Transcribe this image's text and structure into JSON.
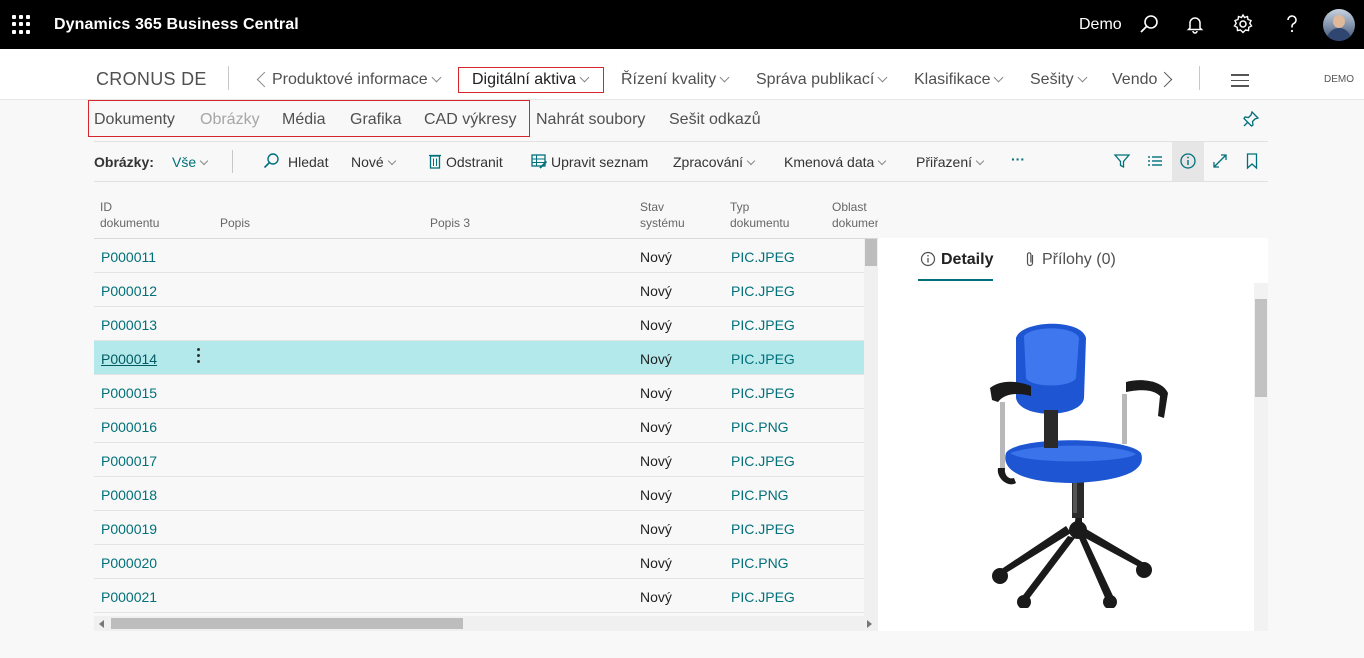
{
  "topbar": {
    "app_title": "Dynamics 365 Business Central",
    "company": "Demo",
    "icons": [
      "waffle-icon",
      "search-icon",
      "bell-icon",
      "gear-icon",
      "help-icon",
      "avatar"
    ]
  },
  "nav": {
    "company": "CRONUS DE",
    "items": [
      {
        "label": "Produktové informace"
      },
      {
        "label": "Digitální aktiva"
      },
      {
        "label": "Řízení kvality"
      },
      {
        "label": "Správa publikací"
      },
      {
        "label": "Klasifikace"
      },
      {
        "label": "Sešity"
      },
      {
        "label": "Vendo"
      }
    ],
    "demo_label": "DEMO"
  },
  "subtabs": {
    "items": [
      {
        "label": "Dokumenty"
      },
      {
        "label": "Obrázky"
      },
      {
        "label": "Média"
      },
      {
        "label": "Grafika"
      },
      {
        "label": "CAD výkresy"
      },
      {
        "label": "Nahrát soubory"
      },
      {
        "label": "Sešit odkazů"
      }
    ]
  },
  "actions": {
    "filter_label": "Obrázky:",
    "filter_value": "Vše",
    "search": "Hledat",
    "new": "Nové",
    "delete": "Odstranit",
    "edit_list": "Upravit seznam",
    "process": "Zpracování",
    "master_data": "Kmenová data",
    "assignment": "Přiřazení",
    "more": "···"
  },
  "table": {
    "headers": {
      "id_1": "ID",
      "id_2": "dokumentu",
      "popis": "Popis",
      "popis3": "Popis 3",
      "stav_1": "Stav",
      "stav_2": "systému",
      "typ_1": "Typ",
      "typ_2": "dokumentu",
      "oblast_1": "Oblast",
      "oblast_2": "dokumen"
    },
    "rows": [
      {
        "id": "P000011",
        "stav": "Nový",
        "typ": "PIC.JPEG"
      },
      {
        "id": "P000012",
        "stav": "Nový",
        "typ": "PIC.JPEG"
      },
      {
        "id": "P000013",
        "stav": "Nový",
        "typ": "PIC.JPEG"
      },
      {
        "id": "P000014",
        "stav": "Nový",
        "typ": "PIC.JPEG"
      },
      {
        "id": "P000015",
        "stav": "Nový",
        "typ": "PIC.JPEG"
      },
      {
        "id": "P000016",
        "stav": "Nový",
        "typ": "PIC.PNG"
      },
      {
        "id": "P000017",
        "stav": "Nový",
        "typ": "PIC.JPEG"
      },
      {
        "id": "P000018",
        "stav": "Nový",
        "typ": "PIC.PNG"
      },
      {
        "id": "P000019",
        "stav": "Nový",
        "typ": "PIC.JPEG"
      },
      {
        "id": "P000020",
        "stav": "Nový",
        "typ": "PIC.PNG"
      },
      {
        "id": "P000021",
        "stav": "Nový",
        "typ": "PIC.JPEG"
      }
    ],
    "selected_id": "P000014"
  },
  "factbox": {
    "tab_details": "Detaily",
    "tab_attachments": "Přílohy (0)",
    "image": "office-chair-image"
  },
  "colors": {
    "accent": "#00707a",
    "highlight_box": "#d6252b",
    "selected_row": "#b4e9ec",
    "topbar": "#000000"
  }
}
